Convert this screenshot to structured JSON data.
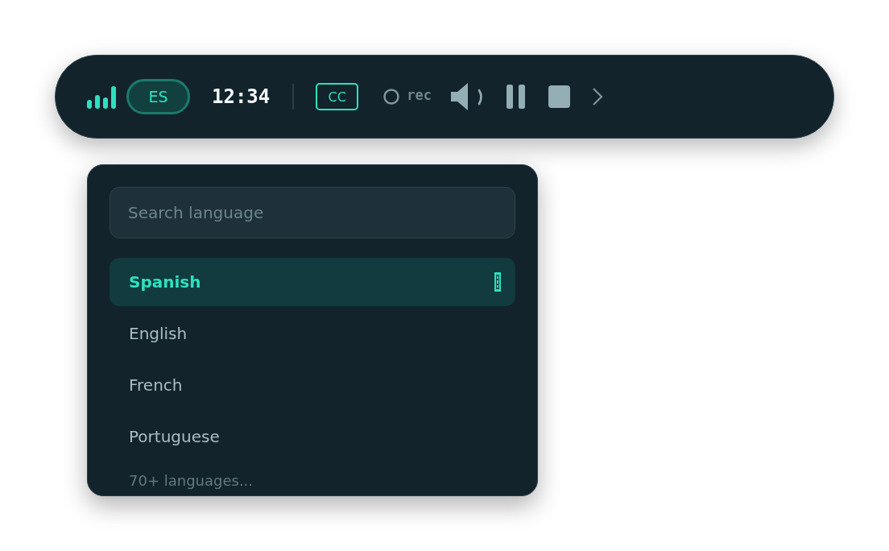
{
  "toolbar": {
    "language_badge": "ES",
    "time": "12:34",
    "captions": {
      "label": "CC",
      "on": true
    },
    "record": {
      "label": "rec",
      "on": false
    }
  },
  "language_menu": {
    "search": {
      "placeholder": "Search language"
    },
    "languages": [
      {
        "name": "Spanish",
        "selected": true
      },
      {
        "name": "English",
        "selected": false
      },
      {
        "name": "French",
        "selected": false
      },
      {
        "name": "Portuguese",
        "selected": false
      }
    ],
    "more": "70+ languages..."
  }
}
